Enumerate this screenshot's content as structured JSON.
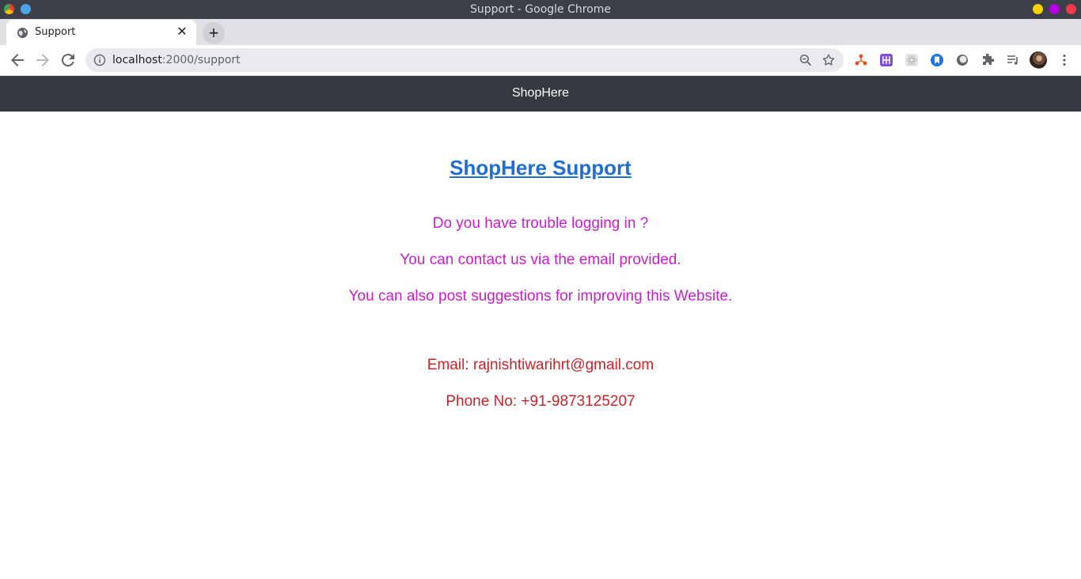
{
  "window": {
    "title": "Support - Google Chrome"
  },
  "tabs": [
    {
      "label": "Support",
      "close": "✕"
    }
  ],
  "toolbar": {
    "new_tab": "+",
    "url_host": "localhost",
    "url_path": ":2000/support"
  },
  "page": {
    "brand": "ShopHere",
    "heading": "ShopHere Support",
    "messages": [
      "Do you have trouble logging in ?",
      "You can contact us via the email provided.",
      "You can also post suggestions for improving this Website."
    ],
    "email": "Email: rajnishtiwarihrt@gmail.com",
    "phone": "Phone No: +91-9873125207"
  },
  "colors": {
    "navbar": "#343a40",
    "heading_link": "#1f6ed4",
    "message_text": "#c81ec9",
    "contact_text": "#cc2228"
  }
}
